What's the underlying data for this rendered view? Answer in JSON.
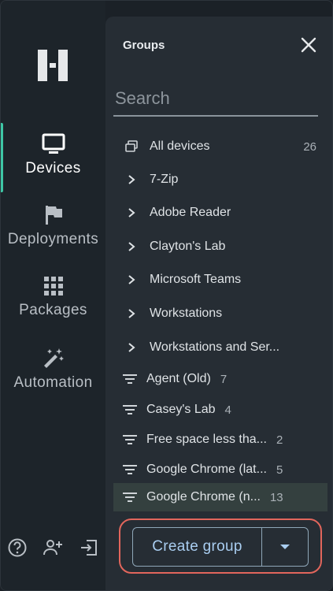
{
  "rail": {
    "items": [
      {
        "label": "Devices",
        "icon": "monitor-icon",
        "active": true
      },
      {
        "label": "Deployments",
        "icon": "flag-icon",
        "active": false
      },
      {
        "label": "Packages",
        "icon": "grid-icon",
        "active": false
      },
      {
        "label": "Automation",
        "icon": "magic-wand-icon",
        "active": false
      }
    ],
    "bottom_icons": [
      "help-icon",
      "add-user-icon",
      "logout-icon"
    ]
  },
  "panel": {
    "title": "Groups",
    "search_placeholder": "Search",
    "all_devices": {
      "label": "All devices",
      "count": "26"
    },
    "folders": [
      {
        "label": "7-Zip"
      },
      {
        "label": "Adobe Reader"
      },
      {
        "label": "Clayton's Lab"
      },
      {
        "label": "Microsoft Teams"
      },
      {
        "label": "Workstations"
      },
      {
        "label": "Workstations and Ser..."
      }
    ],
    "filters": [
      {
        "label": "Agent (Old)",
        "count": "7"
      },
      {
        "label": "Casey's Lab",
        "count": "4"
      },
      {
        "label": "Free space less tha...",
        "count": "2"
      },
      {
        "label": "Google Chrome (lat...",
        "count": "5"
      },
      {
        "label": "Google Chrome (n...",
        "count": "13",
        "selected": true
      }
    ],
    "create_label": "Create group"
  },
  "colors": {
    "accent": "#3ec7a6",
    "highlight": "#e2665c",
    "button_text": "#a9cdf0"
  }
}
